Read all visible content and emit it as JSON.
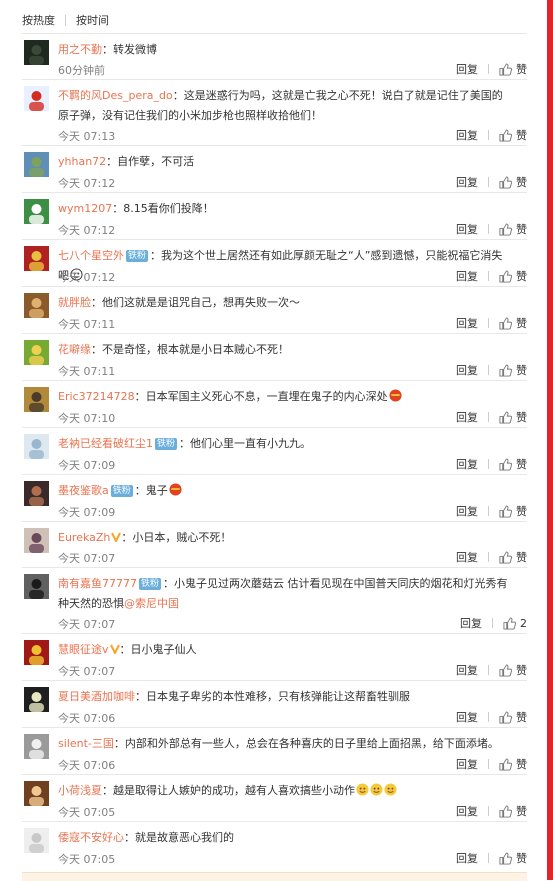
{
  "sort": {
    "hot": "按热度",
    "time": "按时间"
  },
  "reply_label": "回复",
  "like_label": "赞",
  "comments": [
    {
      "user": "用之不勤",
      "badge": "",
      "text": "：转发微博",
      "time": "60分钟前",
      "likes": ""
    },
    {
      "user": "不羁的风Des_pera_do",
      "badge": "",
      "text": "：这是迷惑行为吗，这就是亡我之心不死！说白了就是记住了美国的原子弹，没有记住我们的小米加步枪也照样收拾他们！",
      "time": "今天 07:13",
      "likes": ""
    },
    {
      "user": "yhhan72",
      "badge": "",
      "text": "：自作孽，不可活",
      "time": "今天 07:12",
      "likes": ""
    },
    {
      "user": "wym1207",
      "badge": "",
      "text": "：8.15看你们投降！",
      "time": "今天 07:12",
      "likes": ""
    },
    {
      "user": "七八个星空外",
      "badge": "铁粉",
      "text": "：我为这个世上居然还有如此厚颜无耻之“人”感到遗憾，只能祝福它消失吧",
      "time": "今天 07:12",
      "likes": ""
    },
    {
      "user": "就胖脸",
      "badge": "",
      "text": "：他们这就是是诅咒自己，想再失败一次～",
      "time": "今天 07:11",
      "likes": ""
    },
    {
      "user": "花噼缘",
      "badge": "",
      "text": "：不是奇怪，根本就是小日本贼心不死！",
      "time": "今天 07:11",
      "likes": ""
    },
    {
      "user": "Eric37214728",
      "badge": "",
      "text": "：日本军国主义死心不息，一直埋在鬼子的内心深处",
      "time": "今天 07:10",
      "likes": ""
    },
    {
      "user": "老衲已经看破红尘1",
      "badge": "铁粉",
      "text": "：他们心里一直有小九九。",
      "time": "今天 07:09",
      "likes": ""
    },
    {
      "user": "墨夜鉴歌a",
      "badge": "铁粉",
      "text": "：鬼子",
      "time": "今天 07:09",
      "likes": ""
    },
    {
      "user": "EurekaZh",
      "badge": "",
      "text": "：小日本，贼心不死！",
      "time": "今天 07:07",
      "likes": ""
    },
    {
      "user": "南有嘉鱼77777",
      "badge": "铁粉",
      "text": "：小鬼子见过两次蘑菇云 估计看见现在中国普天同庆的烟花和灯光秀有种天然的恐惧",
      "mention": "@索尼中国",
      "time": "今天 07:07",
      "likes": "2"
    },
    {
      "user": "慧眼征途v",
      "badge": "",
      "text": "：日小鬼子仙人",
      "time": "今天 07:07",
      "likes": ""
    },
    {
      "user": "夏日美酒加咖啡",
      "badge": "",
      "text": "：日本鬼子卑劣的本性难移，只有核弹能让这帮畜牲驯服",
      "time": "今天 07:06",
      "likes": ""
    },
    {
      "user": "silent-三国",
      "badge": "",
      "text": "：内部和外部总有一些人，总会在各种喜庆的日子里给上面招黑，给下面添堵。",
      "time": "今天 07:06",
      "likes": ""
    },
    {
      "user": "小荷浅夏",
      "badge": "",
      "text": "：越是取得让人嫉妒的成功，越有人喜欢搞些小动作",
      "time": "今天 07:05",
      "likes": ""
    },
    {
      "user": "倭寇不安好心",
      "badge": "",
      "text": "：就是故意恶心我们的",
      "time": "今天 07:05",
      "likes": ""
    }
  ],
  "colors": {
    "username": "#eb7350",
    "badge": "#6aaedc",
    "frame": "#e1252b",
    "time": "#808080"
  }
}
